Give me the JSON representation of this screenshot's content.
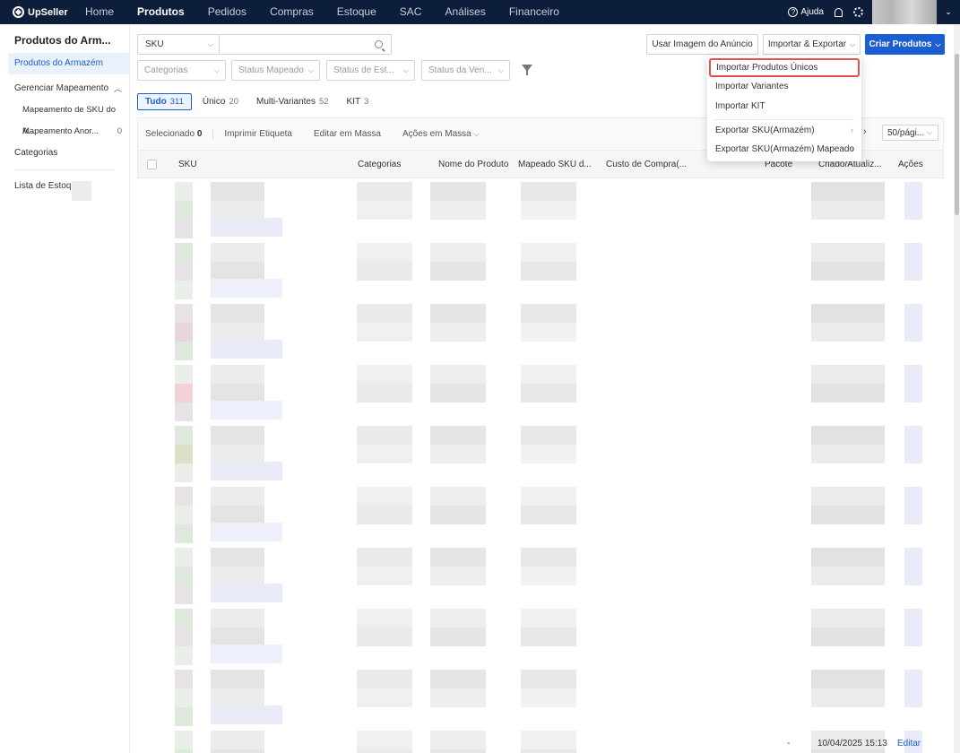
{
  "brand": "UpSeller",
  "nav": {
    "items": [
      "Home",
      "Produtos",
      "Pedidos",
      "Compras",
      "Estoque",
      "SAC",
      "Análises",
      "Financeiro"
    ],
    "active": "Produtos",
    "help": "Ajuda"
  },
  "sidebar": {
    "title": "Produtos do Arm...",
    "items": [
      {
        "label": "Produtos do Armazém"
      },
      {
        "label": "Gerenciar Mapeamento"
      },
      {
        "label": "Mapeamento de SKU do A..."
      },
      {
        "label": "Mapeamento Anor...",
        "count": "0"
      },
      {
        "label": "Categorias"
      },
      {
        "label": "Lista de Estoqu"
      }
    ]
  },
  "search": {
    "field_select": "SKU",
    "placeholder": ""
  },
  "actions": {
    "use_image": "Usar Imagem do Anúncio",
    "import_export": "Importar & Exportar",
    "create": "Criar Produtos"
  },
  "filters": [
    "Categorias",
    "Status Mapeado",
    "Status de Est...",
    "Status da Ven..."
  ],
  "tabs": [
    {
      "label": "Tudo",
      "count": "311"
    },
    {
      "label": "Único",
      "count": "20"
    },
    {
      "label": "Multi-Variantes",
      "count": "52"
    },
    {
      "label": "KIT",
      "count": "3"
    }
  ],
  "toolbar": {
    "selected_label": "Selecionado",
    "selected_count": "0",
    "print": "Imprimir Etiqueta",
    "bulk_edit": "Editar em Massa",
    "bulk_actions": "Ações em Massa",
    "per_page": "50/pági..."
  },
  "table": {
    "columns": [
      "SKU",
      "Categorias",
      "Nome do Produto",
      "Mapeado SKU d...",
      "Custo de Compra(...",
      "Pacote",
      "Criado/Atualiz...",
      "Ações"
    ],
    "last_row": {
      "pacote": "-",
      "date": "10/04/2025 15:13",
      "action": "Editar"
    }
  },
  "dropdown": {
    "items": [
      {
        "label": "Importar Produtos Únicos",
        "highlight": true
      },
      {
        "label": "Importar Variantes"
      },
      {
        "label": "Importar KIT"
      },
      {
        "label": "Exportar SKU(Armazém)",
        "submenu": true
      },
      {
        "label": "Exportar SKU(Armazém) Mapeado",
        "submenu": true
      }
    ]
  }
}
